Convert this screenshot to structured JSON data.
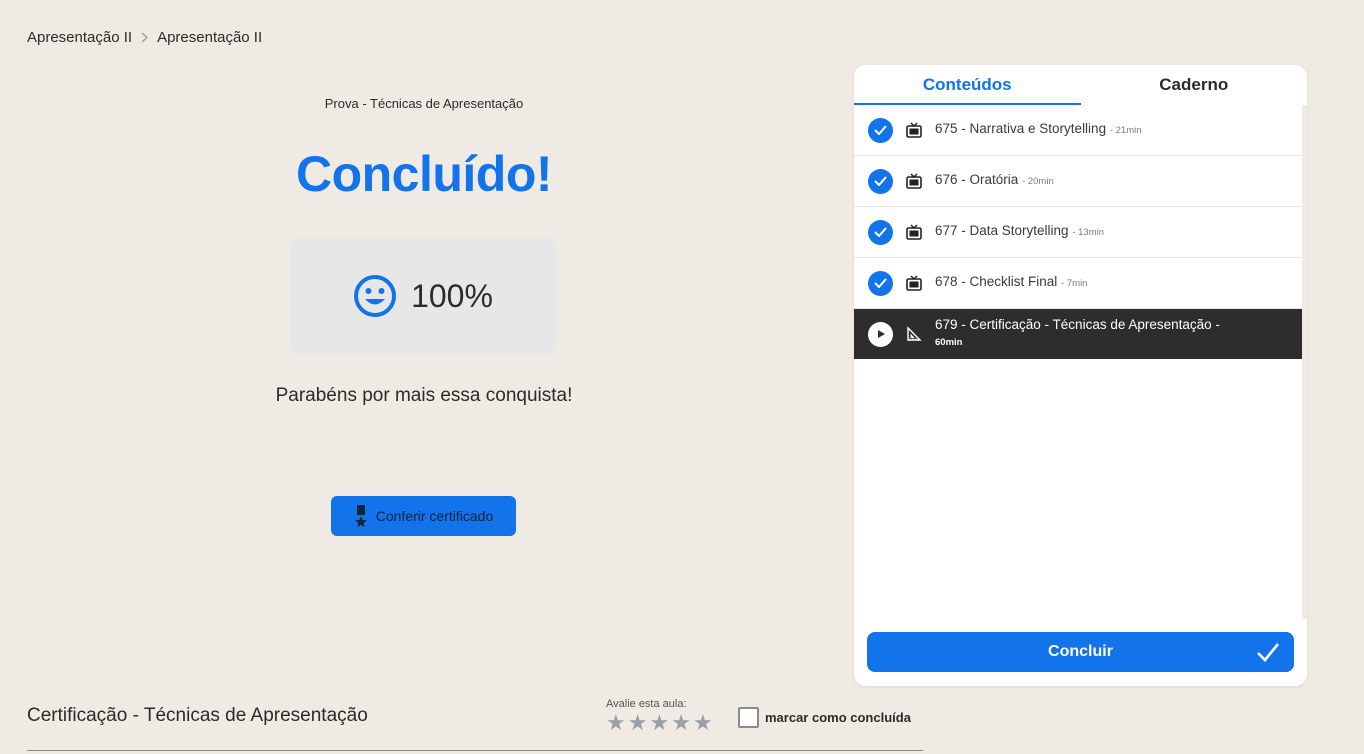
{
  "breadcrumb": {
    "first": "Apresentação II",
    "separator": ">",
    "second": "Apresentação II"
  },
  "main": {
    "exam_label": "Prova - Técnicas de Apresentação",
    "title": "Concluído!",
    "score": "100%",
    "message": "Parabéns por mais essa conquista!",
    "certificate_button": "Conferir certificado"
  },
  "panel": {
    "tabs": [
      "Conteúdos",
      "Caderno"
    ],
    "items": [
      {
        "title": "675 - Narrativa e Storytelling",
        "duration": "- 21min",
        "status": "done",
        "type": "video"
      },
      {
        "title": "676 - Oratória",
        "duration": "- 20min",
        "status": "done",
        "type": "video"
      },
      {
        "title": "677 - Data Storytelling",
        "duration": "- 13min",
        "status": "done",
        "type": "video"
      },
      {
        "title": "678 - Checklist Final",
        "duration": "- 7min",
        "status": "done",
        "type": "video"
      },
      {
        "title": "679 - Certificação - Técnicas de Apresentação -",
        "duration": "60min",
        "status": "current",
        "type": "exam"
      }
    ],
    "conclude_button": "Concluir"
  },
  "footer": {
    "lesson_title": "Certificação - Técnicas de Apresentação",
    "rate_label": "Avalie esta aula:",
    "stars": [
      "★",
      "★",
      "★",
      "★",
      "★"
    ],
    "mark_done_label": "marcar como concluída"
  },
  "colors": {
    "accent": "#1273eb",
    "background": "#efeae4",
    "current_row": "#2d2d2d"
  }
}
